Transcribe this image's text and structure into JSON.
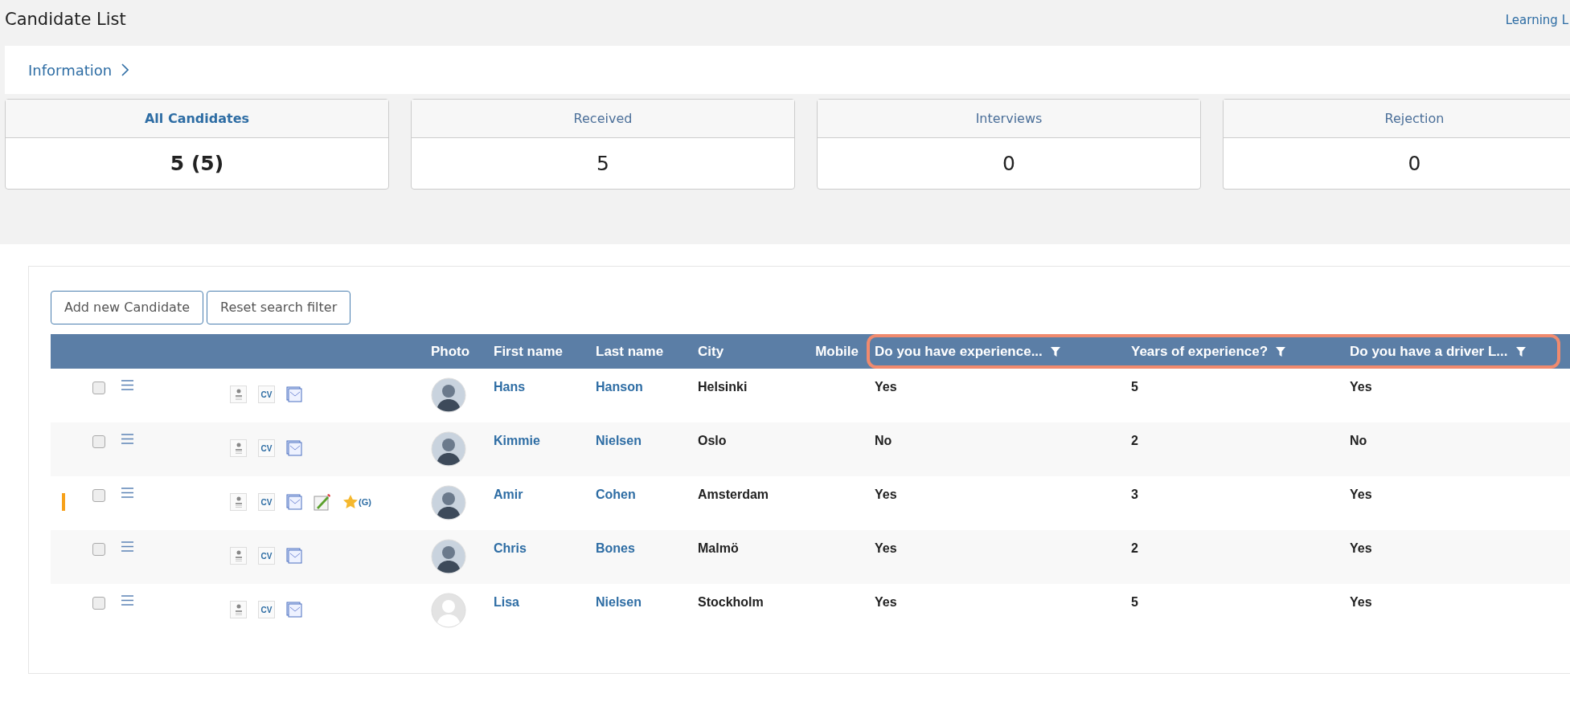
{
  "page_title": "Candidate List",
  "top_link": "Learning L",
  "info_bar": {
    "label": "Information"
  },
  "stat_cards": [
    {
      "label": "All Candidates",
      "value": "5 (5)",
      "selected": true
    },
    {
      "label": "Received",
      "value": "5",
      "selected": false
    },
    {
      "label": "Interviews",
      "value": "0",
      "selected": false
    },
    {
      "label": "Rejection",
      "value": "0",
      "selected": false
    }
  ],
  "buttons": [
    "Add new Candidate",
    "Reset search filter"
  ],
  "table": {
    "columns": [
      {
        "kind": "photo",
        "label": "Photo",
        "filter": false,
        "highlighted": false
      },
      {
        "kind": "link",
        "label": "First name",
        "filter": false,
        "highlighted": false
      },
      {
        "kind": "link",
        "label": "Last name",
        "filter": false,
        "highlighted": false
      },
      {
        "kind": "text",
        "label": "City",
        "filter": false,
        "highlighted": false
      },
      {
        "kind": "text",
        "label": "Mobile",
        "filter": false,
        "highlighted": false
      },
      {
        "kind": "text",
        "label": "Do you have experience...",
        "filter": true,
        "highlighted": true
      },
      {
        "kind": "text",
        "label": "Years of experience?",
        "filter": true,
        "highlighted": true
      },
      {
        "kind": "text",
        "label": "Do you have a driver L...",
        "filter": true,
        "highlighted": true
      }
    ],
    "rows": [
      {
        "checked": false,
        "flagged": false,
        "starred": false,
        "icons": [
          {
            "kind": "profile"
          },
          {
            "kind": "cv",
            "text": "CV"
          },
          {
            "kind": "mail"
          }
        ],
        "avatar": {
          "kind": "photo"
        },
        "cells": [
          "",
          "Hans",
          "Hanson",
          "Helsinki",
          "",
          "Yes",
          "5",
          "Yes"
        ]
      },
      {
        "checked": false,
        "flagged": false,
        "starred": false,
        "icons": [
          {
            "kind": "profile"
          },
          {
            "kind": "cv",
            "text": "CV"
          },
          {
            "kind": "mail"
          }
        ],
        "avatar": {
          "kind": "photo"
        },
        "cells": [
          "",
          "Kimmie",
          "Nielsen",
          "Oslo",
          "",
          "No",
          "2",
          "No"
        ]
      },
      {
        "checked": false,
        "flagged": true,
        "starred": true,
        "star_text": "(G)",
        "icons": [
          {
            "kind": "profile"
          },
          {
            "kind": "cv",
            "text": "CV"
          },
          {
            "kind": "mail"
          },
          {
            "kind": "edit"
          }
        ],
        "avatar": {
          "kind": "photo"
        },
        "cells": [
          "",
          "Amir",
          "Cohen",
          "Amsterdam",
          "",
          "Yes",
          "3",
          "Yes"
        ]
      },
      {
        "checked": false,
        "flagged": false,
        "starred": false,
        "icons": [
          {
            "kind": "profile"
          },
          {
            "kind": "cv",
            "text": "CV"
          },
          {
            "kind": "mail"
          }
        ],
        "avatar": {
          "kind": "photo"
        },
        "cells": [
          "",
          "Chris",
          "Bones",
          "Malmö",
          "",
          "Yes",
          "2",
          "Yes"
        ]
      },
      {
        "checked": false,
        "flagged": false,
        "starred": false,
        "icons": [
          {
            "kind": "profile"
          },
          {
            "kind": "cv",
            "text": "CV"
          },
          {
            "kind": "mail"
          }
        ],
        "avatar": {
          "kind": "placeholder"
        },
        "cells": [
          "",
          "Lisa",
          "Nielsen",
          "Stockholm",
          "",
          "Yes",
          "5",
          "Yes"
        ]
      }
    ]
  }
}
